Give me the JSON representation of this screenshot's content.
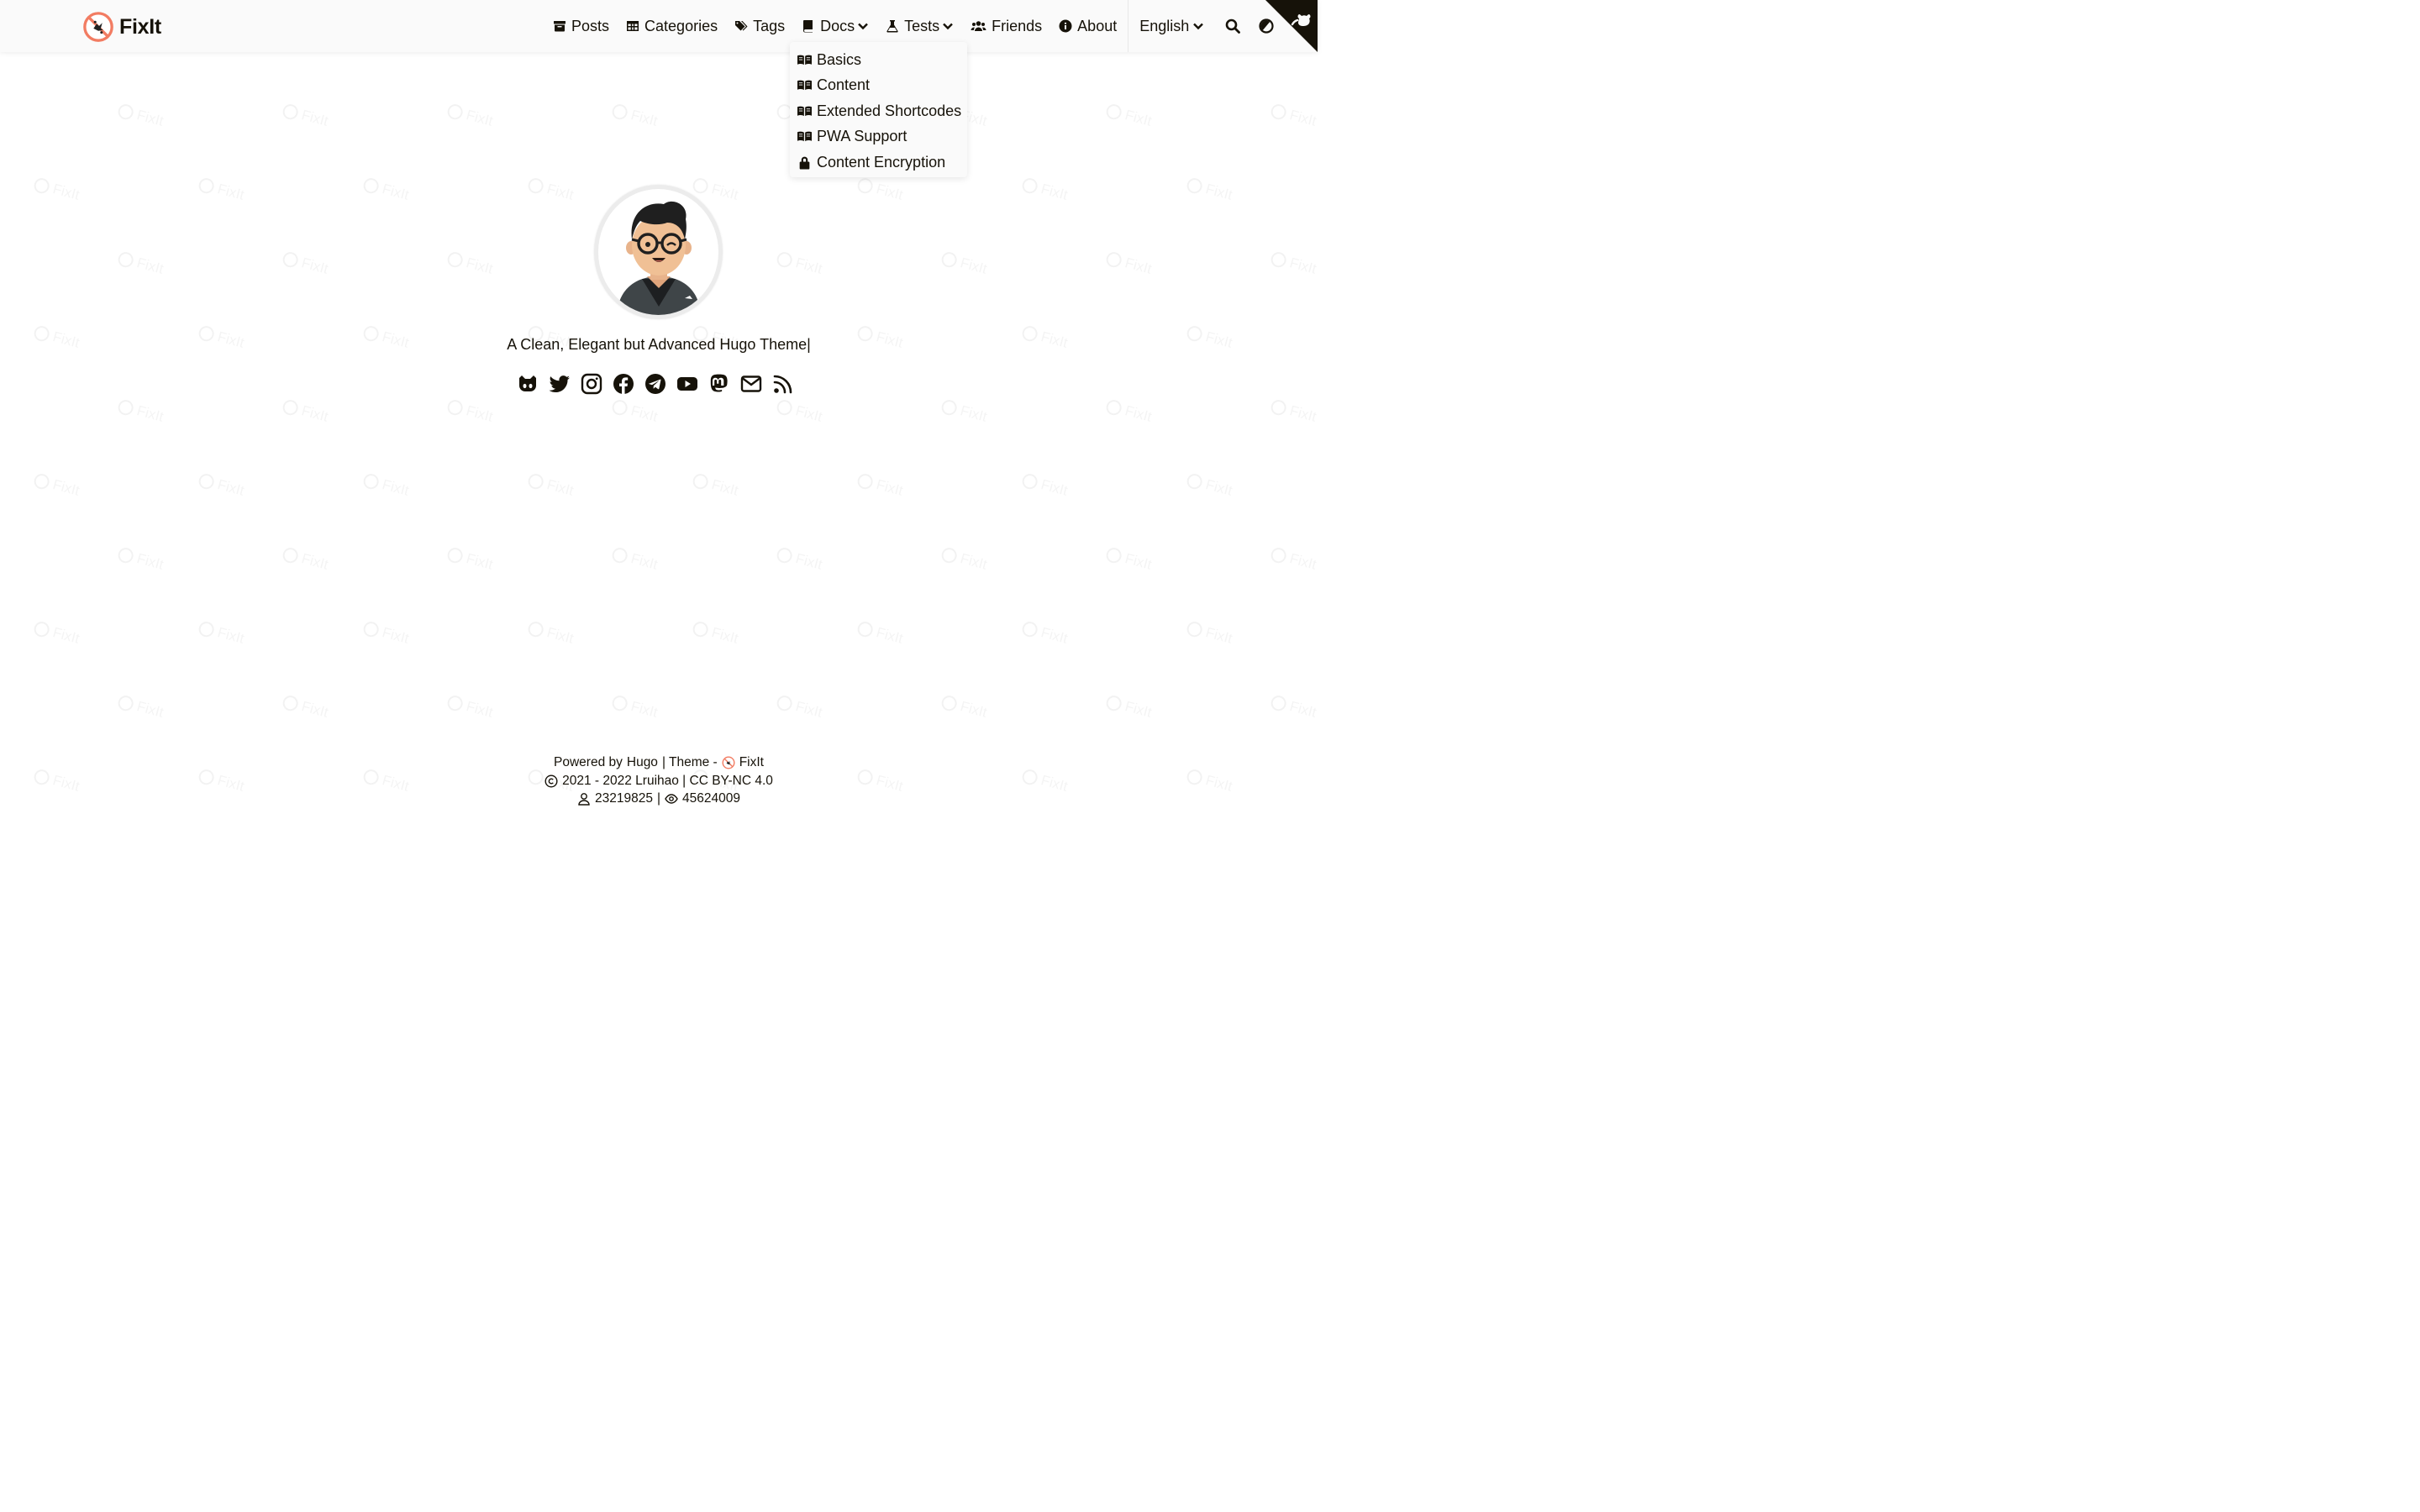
{
  "brand": {
    "name": "FixIt"
  },
  "nav": {
    "items": [
      {
        "label": "Posts",
        "icon": "archive-icon"
      },
      {
        "label": "Categories",
        "icon": "table-icon"
      },
      {
        "label": "Tags",
        "icon": "tags-icon"
      },
      {
        "label": "Docs",
        "icon": "book-icon",
        "dropdown": true
      },
      {
        "label": "Tests",
        "icon": "flask-icon",
        "dropdown": true
      },
      {
        "label": "Friends",
        "icon": "users-icon"
      },
      {
        "label": "About",
        "icon": "info-circle-icon"
      }
    ],
    "language": "English"
  },
  "docs_dropdown": {
    "items": [
      {
        "label": "Basics",
        "icon": "book-open-icon"
      },
      {
        "label": "Content",
        "icon": "book-open-icon"
      },
      {
        "label": "Extended Shortcodes",
        "icon": "book-open-icon"
      },
      {
        "label": "PWA Support",
        "icon": "book-open-icon"
      },
      {
        "label": "Content Encryption",
        "icon": "lock-icon"
      }
    ]
  },
  "profile": {
    "subtitle": "A Clean, Elegant but Advanced Hugo Theme|",
    "social": [
      "github-icon",
      "twitter-icon",
      "instagram-icon",
      "facebook-icon",
      "telegram-icon",
      "youtube-icon",
      "mastodon-icon",
      "email-icon",
      "rss-icon"
    ]
  },
  "footer": {
    "powered_prefix": "Powered by",
    "hugo": "Hugo",
    "theme_prefix": "| Theme -",
    "theme_name": "FixIt",
    "copyright": "2021 - 2022 Lruihao | CC BY-NC 4.0",
    "visitors": "23219825",
    "views": "45624009"
  },
  "colors": {
    "brand_accent": "#f27c62",
    "text": "#161209",
    "header_bg": "#fafafa"
  }
}
